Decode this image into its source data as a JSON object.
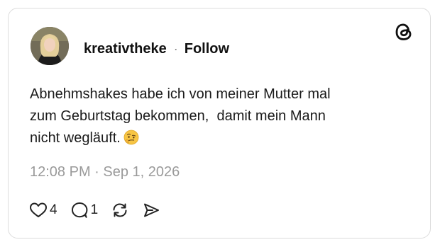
{
  "post": {
    "username": "kreativtheke",
    "separator": "·",
    "follow_label": "Follow",
    "text_lines": [
      "Abnehmshakes habe ich von meiner Mutter mal",
      "zum Geburtstag bekommen,  damit mein Mann",
      "nicht wegläuft."
    ],
    "emoji": "face-with-raised-eyebrow-icon",
    "timestamp": "12:08 PM · Sep 1, 2026"
  },
  "actions": {
    "like_count": "4",
    "reply_count": "1"
  },
  "icons": {
    "brand": "threads-logo-icon",
    "like": "heart-icon",
    "reply": "comment-bubble-icon",
    "repost": "repost-icon",
    "share": "send-icon"
  },
  "colors": {
    "text": "#111111",
    "muted": "#9a9a9a",
    "border": "#dcdcdc",
    "background": "#ffffff"
  }
}
